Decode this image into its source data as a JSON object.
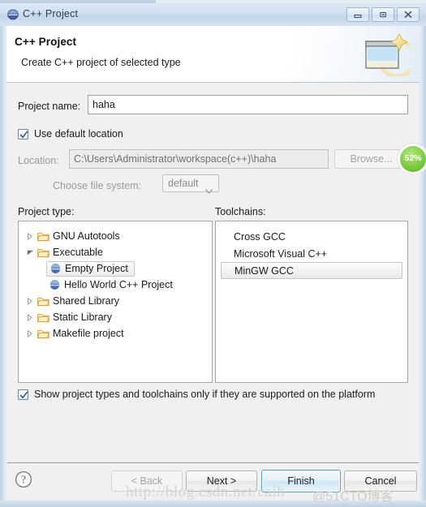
{
  "window": {
    "title": "C++ Project",
    "title_icon": "sphere-icon",
    "controls": {
      "minimize": "minimize-icon",
      "maximize": "restore-icon",
      "close": "close-icon"
    }
  },
  "wizard_header": {
    "title": "C++ Project",
    "subtitle": "Create C++ project of selected type",
    "banner_icon": "new-project-window-icon"
  },
  "form": {
    "project_name_label": "Project name:",
    "project_name_value": "haha",
    "project_name_placeholder": "",
    "use_default_location_label": "Use default location",
    "use_default_location_checked": true,
    "location_label": "Location:",
    "location_value": "C:\\Users\\Administrator\\workspace(c++)\\haha",
    "browse_label": "Browse...",
    "choose_file_system_label": "Choose file system:",
    "file_system_value": "default",
    "file_system_options": [
      "default"
    ]
  },
  "project_type": {
    "caption": "Project type:",
    "items": [
      {
        "label": "GNU Autotools",
        "icon": "folder-icon",
        "expander": "collapsed",
        "depth": 0,
        "selected": false
      },
      {
        "label": "Executable",
        "icon": "folder-icon",
        "expander": "expanded",
        "depth": 0,
        "selected": false
      },
      {
        "label": "Empty Project",
        "icon": "sphere-icon",
        "expander": "none",
        "depth": 1,
        "selected": true
      },
      {
        "label": "Hello World C++ Project",
        "icon": "sphere-icon",
        "expander": "none",
        "depth": 1,
        "selected": false
      },
      {
        "label": "Shared Library",
        "icon": "folder-icon",
        "expander": "collapsed",
        "depth": 0,
        "selected": false
      },
      {
        "label": "Static Library",
        "icon": "folder-icon",
        "expander": "collapsed",
        "depth": 0,
        "selected": false
      },
      {
        "label": "Makefile project",
        "icon": "folder-icon",
        "expander": "collapsed",
        "depth": 0,
        "selected": false
      }
    ]
  },
  "toolchains": {
    "caption": "Toolchains:",
    "items": [
      {
        "label": "Cross GCC",
        "selected": false
      },
      {
        "label": "Microsoft Visual C++",
        "selected": false
      },
      {
        "label": "MinGW GCC",
        "selected": true
      }
    ]
  },
  "show_supported": {
    "label": "Show project types and toolchains only if they are supported on the platform",
    "checked": true
  },
  "footer": {
    "help_icon": "help-question-icon",
    "back_label": "< Back",
    "back_enabled": false,
    "next_label": "Next >",
    "finish_label": "Finish",
    "cancel_label": "Cancel"
  },
  "overlays": {
    "progress_badge": "52%",
    "watermark": "http://blog.csdn.net/caih",
    "watermark_secondary": "@51CTO博客"
  }
}
